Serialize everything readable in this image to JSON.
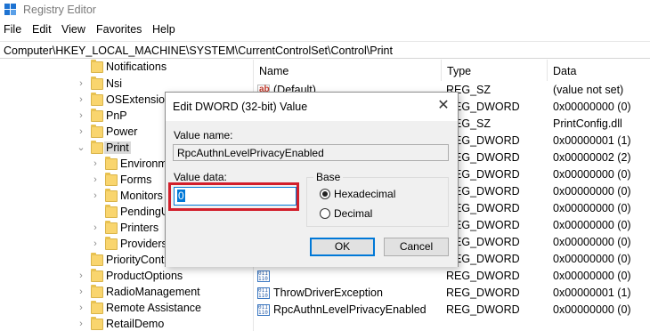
{
  "window": {
    "title": "Registry Editor",
    "icon": "registry-editor-icon"
  },
  "menu": [
    "File",
    "Edit",
    "View",
    "Favorites",
    "Help"
  ],
  "address": "Computer\\HKEY_LOCAL_MACHINE\\SYSTEM\\CurrentControlSet\\Control\\Print",
  "tree": [
    {
      "label": "Notifications"
    },
    {
      "label": "Nsi"
    },
    {
      "label": "OSExtension"
    },
    {
      "label": "PnP"
    },
    {
      "label": "Power"
    },
    {
      "label": "Print"
    },
    {
      "label": "Environm"
    },
    {
      "label": "Forms"
    },
    {
      "label": "Monitors"
    },
    {
      "label": "PendingU"
    },
    {
      "label": "Printers"
    },
    {
      "label": "Providers"
    },
    {
      "label": "PriorityContr"
    },
    {
      "label": "ProductOptions"
    },
    {
      "label": "RadioManagement"
    },
    {
      "label": "Remote Assistance"
    },
    {
      "label": "RetailDemo"
    }
  ],
  "list": {
    "headers": [
      "Name",
      "Type",
      "Data"
    ],
    "rows": [
      {
        "name": "(Default)",
        "type": "REG_SZ",
        "data": "(value not set)",
        "icon": "string-value-icon"
      },
      {
        "name": "",
        "type": "REG_DWORD",
        "data": "0x00000000 (0)",
        "icon": "dword-value-icon"
      },
      {
        "name": "",
        "type": "REG_SZ",
        "data": "PrintConfig.dll",
        "icon": "string-value-icon"
      },
      {
        "name": "",
        "type": "REG_DWORD",
        "data": "0x00000001 (1)",
        "icon": "dword-value-icon"
      },
      {
        "name": "",
        "type": "REG_DWORD",
        "data": "0x00000002 (2)",
        "icon": "dword-value-icon"
      },
      {
        "name": "",
        "type": "REG_DWORD",
        "data": "0x00000000 (0)",
        "icon": "dword-value-icon"
      },
      {
        "name": "",
        "type": "REG_DWORD",
        "data": "0x00000000 (0)",
        "icon": "dword-value-icon"
      },
      {
        "name": "",
        "type": "REG_DWORD",
        "data": "0x00000000 (0)",
        "icon": "dword-value-icon"
      },
      {
        "name": "",
        "type": "REG_DWORD",
        "data": "0x00000000 (0)",
        "icon": "dword-value-icon"
      },
      {
        "name": "",
        "type": "REG_DWORD",
        "data": "0x00000000 (0)",
        "icon": "dword-value-icon"
      },
      {
        "name": "",
        "type": "REG_DWORD",
        "data": "0x00000000 (0)",
        "icon": "dword-value-icon"
      },
      {
        "name": "",
        "type": "REG_DWORD",
        "data": "0x00000000 (0)",
        "icon": "dword-value-icon"
      },
      {
        "name": "ThrowDriverException",
        "type": "REG_DWORD",
        "data": "0x00000001 (1)",
        "icon": "dword-value-icon"
      },
      {
        "name": "RpcAuthnLevelPrivacyEnabled",
        "type": "REG_DWORD",
        "data": "0x00000000 (0)",
        "icon": "dword-value-icon"
      }
    ]
  },
  "dialog": {
    "title": "Edit DWORD (32-bit) Value",
    "value_name_label": "Value name:",
    "value_name": "RpcAuthnLevelPrivacyEnabled",
    "value_data_label": "Value data:",
    "value_data": "0",
    "base_label": "Base",
    "hex_label": "Hexadecimal",
    "dec_label": "Decimal",
    "selected_base": "Hexadecimal",
    "ok_label": "OK",
    "cancel_label": "Cancel",
    "highlight_color": "#d21f2b"
  }
}
